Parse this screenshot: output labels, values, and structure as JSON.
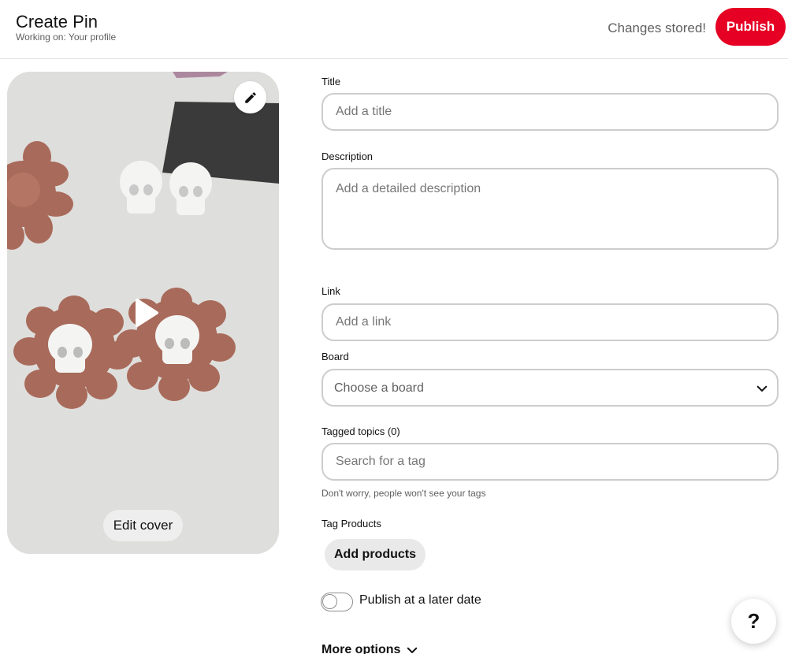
{
  "header": {
    "title": "Create Pin",
    "subtitle": "Working on: Your profile",
    "status": "Changes stored!",
    "publish_label": "Publish"
  },
  "media": {
    "edit_cover_label": "Edit cover",
    "edit_icon": "pencil-icon",
    "play_icon": "play-icon"
  },
  "form": {
    "title_label": "Title",
    "title_placeholder": "Add a title",
    "description_label": "Description",
    "description_placeholder": "Add a detailed description",
    "link_label": "Link",
    "link_placeholder": "Add a link",
    "board_label": "Board",
    "board_value": "Choose a board",
    "tags_label": "Tagged topics (0)",
    "tags_placeholder": "Search for a tag",
    "tags_helper": "Don't worry, people won't see your tags",
    "products_label": "Tag Products",
    "add_products_label": "Add products",
    "publish_later_label": "Publish at a later date",
    "publish_later_enabled": false,
    "more_options_label": "More options"
  },
  "help": {
    "label": "?"
  },
  "colors": {
    "accent": "#e60023",
    "border": "#cdcdcd",
    "muted_text": "#5f5f5f"
  }
}
